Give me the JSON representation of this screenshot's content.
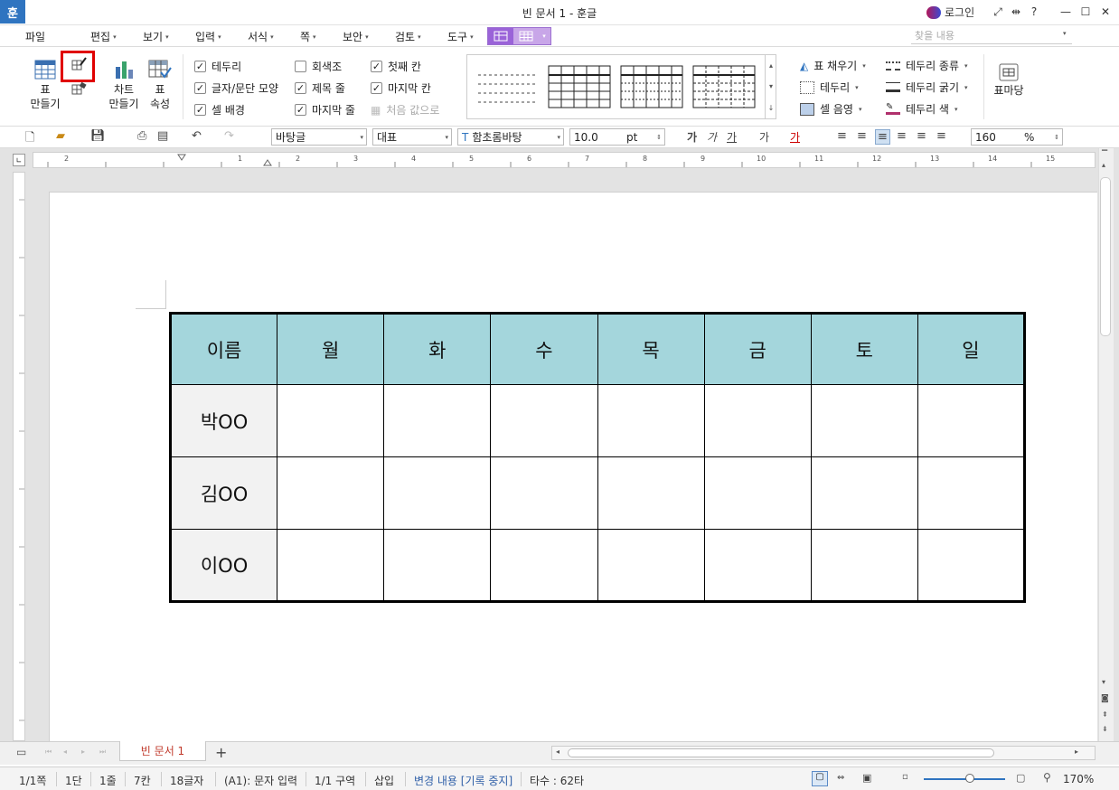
{
  "titlebar": {
    "app_logo": "훈",
    "title": "빈 문서 1 - 훈글",
    "login": "로그인",
    "help": "?"
  },
  "menu": [
    {
      "label": "파일",
      "arrow": ""
    },
    {
      "label": "편집",
      "arrow": "▾"
    },
    {
      "label": "보기",
      "arrow": "▾"
    },
    {
      "label": "입력",
      "arrow": "▾"
    },
    {
      "label": "서식",
      "arrow": "▾"
    },
    {
      "label": "쪽",
      "arrow": "▾"
    },
    {
      "label": "보안",
      "arrow": "▾"
    },
    {
      "label": "검토",
      "arrow": "▾"
    },
    {
      "label": "도구",
      "arrow": "▾"
    }
  ],
  "search_placeholder": "찾을 내용",
  "ribbon": {
    "table_make": "표\n만들기",
    "chart_make": "차트\n만들기",
    "table_props": "표\n속성",
    "checks_col1": [
      {
        "label": "테두리",
        "checked": true
      },
      {
        "label": "글자/문단 모양",
        "checked": true
      },
      {
        "label": "셀 배경",
        "checked": true
      }
    ],
    "checks_col2": [
      {
        "label": "회색조",
        "checked": false
      },
      {
        "label": "제목 줄",
        "checked": true
      },
      {
        "label": "마지막 줄",
        "checked": true
      }
    ],
    "checks_col3": [
      {
        "label": "첫째 칸",
        "checked": true
      },
      {
        "label": "마지막 칸",
        "checked": true
      }
    ],
    "reset_label": "처음 값으로",
    "right_col1": [
      "표 채우기",
      "테두리",
      "셀 음영"
    ],
    "right_col2": [
      "테두리 종류",
      "테두리 굵기",
      "테두리 색"
    ],
    "table_madang": "표마당"
  },
  "toolbar": {
    "style": "바탕글",
    "rep": "대표",
    "font": "함초롬바탕",
    "size": "10.0",
    "unit": "pt",
    "zoom": "160",
    "zoom_unit": "%"
  },
  "ruler_marks": [
    "2",
    "1",
    "1",
    "2",
    "3",
    "4",
    "5",
    "6",
    "7",
    "8",
    "9",
    "10",
    "11",
    "12",
    "13",
    "14",
    "15"
  ],
  "table": {
    "header": [
      "이름",
      "월",
      "화",
      "수",
      "목",
      "금",
      "토",
      "일"
    ],
    "rows": [
      [
        "박OO",
        "",
        "",
        "",
        "",
        "",
        "",
        ""
      ],
      [
        "김OO",
        "",
        "",
        "",
        "",
        "",
        "",
        ""
      ],
      [
        "이OO",
        "",
        "",
        "",
        "",
        "",
        "",
        ""
      ]
    ]
  },
  "doc_tab": "빈 문서 1",
  "status": [
    "1/1쪽",
    "1단",
    "1줄",
    "7칸",
    "18글자",
    "(A1): 문자 입력",
    "1/1 구역",
    "삽입",
    "변경 내용 [기록 중지]",
    "타수 : 62타"
  ],
  "status_zoom": "170%",
  "colors": {
    "header_fill": "#a4d6dc",
    "name_fill": "#f2f2f2",
    "highlight": "#e00000",
    "accent": "#9a63d8"
  }
}
